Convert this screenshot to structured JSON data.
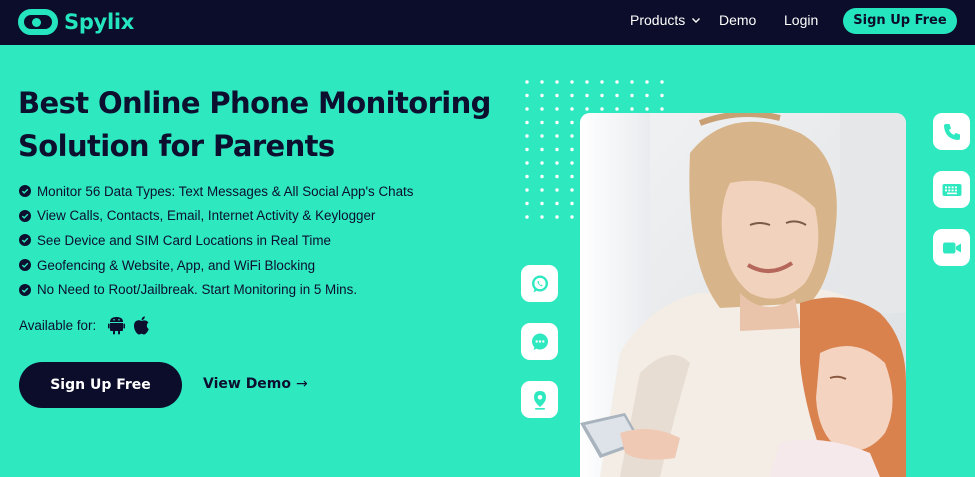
{
  "brand": {
    "name": "Spylix"
  },
  "nav": {
    "products": "Products",
    "demo": "Demo",
    "login": "Login",
    "signup": "Sign Up Free"
  },
  "hero": {
    "title_line1": "Best Online Phone Monitoring",
    "title_line2": "Solution for Parents",
    "features": [
      "Monitor 56 Data Types: Text Messages & All Social App's Chats",
      "View Calls, Contacts, Email, Internet Activity & Keylogger",
      "See Device and SIM Card Locations in Real Time",
      "Geofencing & Website, App, and WiFi Blocking",
      "No Need to Root/Jailbreak. Start Monitoring in 5 Mins."
    ],
    "available_label": "Available for:",
    "platforms": [
      "android-icon",
      "apple-icon"
    ],
    "cta_primary": "Sign Up Free",
    "cta_secondary": "View Demo",
    "cta_secondary_arrow": "→"
  },
  "feature_tiles": {
    "left": [
      "whatsapp-icon",
      "message-icon",
      "location-icon"
    ],
    "right": [
      "phone-icon",
      "keyboard-icon",
      "video-icon"
    ]
  },
  "colors": {
    "background": "#2ee8c0",
    "navbar": "#0b0d2a",
    "accent": "#25e5bf",
    "dark_text": "#0c0f2e"
  }
}
